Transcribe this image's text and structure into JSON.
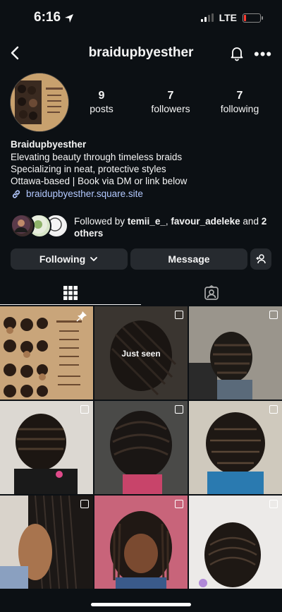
{
  "status": {
    "time": "6:16",
    "network": "LTE"
  },
  "header": {
    "username": "braidupbyesther"
  },
  "stats": [
    {
      "value": "9",
      "label": "posts"
    },
    {
      "value": "7",
      "label": "followers"
    },
    {
      "value": "7",
      "label": "following"
    }
  ],
  "bio": {
    "name": "Braidupbyesther",
    "lines": [
      "Elevating beauty through timeless braids",
      "Specializing in neat, protective styles",
      "Ottawa-based | Book via DM or link below"
    ],
    "link": "braidupbyesther.square.site"
  },
  "followed_by": {
    "prefix": "Followed by ",
    "user1": "temii_e_",
    "sep": ", ",
    "user2": "favour_adeleke",
    "mid": " and ",
    "rest": "2 others"
  },
  "buttons": {
    "following": "Following",
    "message": "Message"
  },
  "grid": {
    "just_seen": "Just seen"
  },
  "colors": {
    "background": "#0c1014",
    "button": "#262a2f",
    "link": "#b3c9ff"
  }
}
